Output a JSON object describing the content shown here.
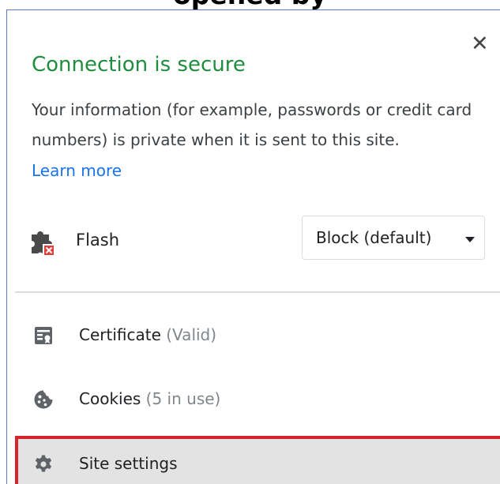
{
  "caption": "opened by",
  "dialog": {
    "title": "Connection is secure",
    "description": "Your information (for example, passwords or credit card numbers) is private when it is sent to this site.",
    "learn_more": "Learn more",
    "close_glyph": "✕",
    "title_color": "#1e8e3e",
    "link_color": "#1a73e8"
  },
  "permission": {
    "icon": "puzzle-plugin-blocked-icon",
    "label": "Flash",
    "select_value": "Block (default)"
  },
  "items": [
    {
      "icon": "certificate-icon",
      "label": "Certificate",
      "sub": "(Valid)"
    },
    {
      "icon": "cookie-icon",
      "label": "Cookies",
      "sub": "(5 in use)"
    },
    {
      "icon": "gear-icon",
      "label": "Site settings",
      "sub": ""
    }
  ],
  "highlight_color": "#d5242b"
}
